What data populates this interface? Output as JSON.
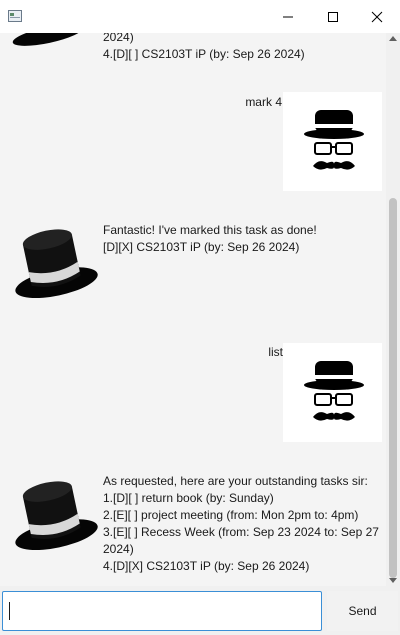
{
  "window": {
    "icons": {
      "app": "app-window-icon",
      "minimize": "minimize-icon",
      "maximize": "maximize-icon",
      "close": "close-icon"
    }
  },
  "messages": [
    {
      "sender": "bot",
      "text": "2024)\n4.[D][ ] CS2103T iP (by: Sep 26 2024)"
    },
    {
      "sender": "user",
      "text": "mark 4"
    },
    {
      "sender": "bot",
      "text": "Fantastic! I've marked this task as done!\n[D][X] CS2103T iP (by: Sep 26 2024)"
    },
    {
      "sender": "user",
      "text": "list"
    },
    {
      "sender": "bot",
      "text": "As requested, here are your outstanding tasks sir:\n1.[D][ ] return book (by: Sunday)\n2.[E][ ] project meeting (from: Mon 2pm to: 4pm)\n3.[E][ ] Recess Week (from: Sep 23 2024 to: Sep 27\n2024)\n4.[D][X] CS2103T iP (by: Sep 26 2024)"
    }
  ],
  "input": {
    "value": "",
    "placeholder": ""
  },
  "send_button": {
    "label": "Send"
  },
  "avatars": {
    "bot": "top-hat-avatar-icon",
    "user": "hat-glasses-mustache-avatar-icon"
  }
}
